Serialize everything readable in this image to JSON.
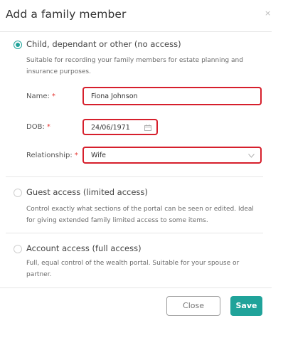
{
  "dialog": {
    "title": "Add a family member",
    "close_symbol": "×"
  },
  "options": [
    {
      "label": "Child, dependant or other (no access)",
      "description": "Suitable for recording your family members for estate planning and insurance purposes.",
      "selected": true
    },
    {
      "label": "Guest access (limited access)",
      "description": "Control exactly what sections of the portal can be seen or edited. Ideal for giving extended family limited access to some items.",
      "selected": false
    },
    {
      "label": "Account access (full access)",
      "description": "Full, equal control of the wealth portal. Suitable for your spouse or partner.",
      "selected": false
    }
  ],
  "form": {
    "name_label": "Name:",
    "name_value": "Fiona Johnson",
    "dob_label": "DOB:",
    "dob_value": "24/06/1971",
    "relationship_label": "Relationship:",
    "relationship_value": "Wife",
    "required_marker": "*"
  },
  "footer": {
    "close_label": "Close",
    "save_label": "Save"
  },
  "colors": {
    "accent": "#20a39a",
    "error_border": "#d61f2c",
    "required": "#e53935"
  },
  "icons": {
    "close": "close-icon",
    "calendar": "calendar-icon",
    "dropdown": "chevron-down-icon"
  }
}
